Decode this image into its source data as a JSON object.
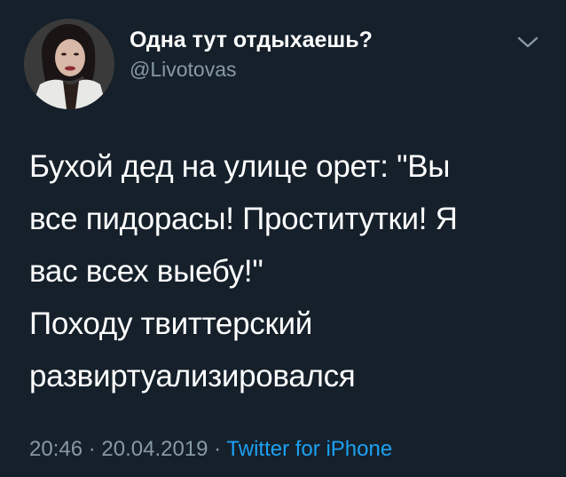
{
  "user": {
    "display_name": "Одна тут отдыхаешь?",
    "handle": "@Livotovas"
  },
  "tweet": {
    "text": "Бухой дед на улице орет: \"Вы\nвсе пидорасы! Проститутки! Я\nвас всех выебу!\"\nПоходу твиттерский\nразвиртуализировался"
  },
  "meta": {
    "time": "20:46",
    "separator": " · ",
    "date": "20.04.2019",
    "source": "Twitter for iPhone"
  },
  "icons": {
    "menu": "chevron-down-icon"
  },
  "colors": {
    "background": "#15202b",
    "secondary_text": "#8899a6",
    "link": "#1da1f2"
  }
}
